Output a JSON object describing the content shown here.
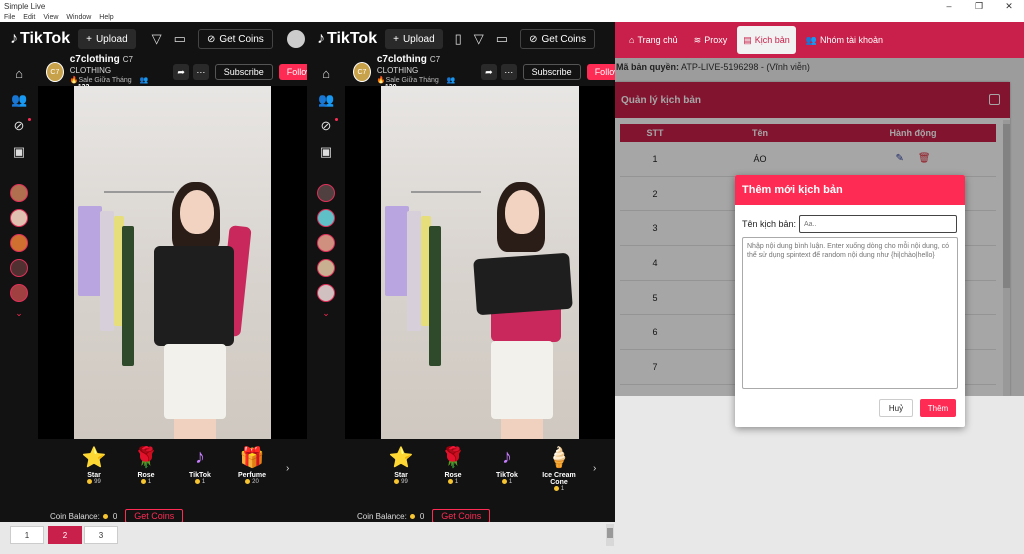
{
  "window": {
    "title": "Simple Live",
    "menu": [
      "File",
      "Edit",
      "View",
      "Window",
      "Help"
    ]
  },
  "tiktok_panes": [
    {
      "logo": "TikTok",
      "upload_label": "Upload",
      "get_coins_label": "Get Coins",
      "host": {
        "name": "c7clothing",
        "display": "C7 CLOTHING",
        "subtitle": "Sale Giữa Tháng",
        "viewers": "132",
        "avatar": "C7"
      },
      "subscribe_label": "Subscribe",
      "follow_label": "Follow",
      "gifts": [
        {
          "name": "Star",
          "price": "99",
          "icon": "⭐"
        },
        {
          "name": "Rose",
          "price": "1",
          "icon": "🌹"
        },
        {
          "name": "TikTok",
          "price": "1",
          "icon": "♪"
        },
        {
          "name": "Perfume",
          "price": "20",
          "icon": "🎁"
        }
      ],
      "balance_label": "Coin Balance:",
      "balance_value": "0",
      "balance_getcoins": "Get Coins"
    },
    {
      "logo": "TikTok",
      "upload_label": "Upload",
      "get_coins_label": "Get Coins",
      "host": {
        "name": "c7clothing",
        "display": "C7 CLOTHING",
        "subtitle": "Sale Giữa Tháng",
        "viewers": "130",
        "avatar": "C7"
      },
      "subscribe_label": "Subscribe",
      "follow_label": "Follow",
      "gifts": [
        {
          "name": "Star",
          "price": "99",
          "icon": "⭐"
        },
        {
          "name": "Rose",
          "price": "1",
          "icon": "🌹"
        },
        {
          "name": "TikTok",
          "price": "1",
          "icon": "♪"
        },
        {
          "name": "Ice Cream Cone",
          "price": "1",
          "icon": "🍦"
        }
      ],
      "balance_label": "Coin Balance:",
      "balance_value": "0",
      "balance_getcoins": "Get Coins"
    }
  ],
  "pager": {
    "pages": [
      "1",
      "2",
      "3"
    ],
    "active": "2"
  },
  "admin": {
    "nav": [
      {
        "label": "Trang chủ",
        "icon": "home-icon"
      },
      {
        "label": "Proxy",
        "icon": "wifi-icon"
      },
      {
        "label": "Kịch bản",
        "icon": "script-icon",
        "active": true
      },
      {
        "label": "Nhóm tài khoản",
        "icon": "users-icon"
      }
    ],
    "license_label": "Mã bản quyền:",
    "license_value": "ATP-LIVE-5196298 - (Vĩnh viễn)",
    "card_title": "Quản lý kịch bản",
    "table_headers": [
      "STT",
      "Tên",
      "Hành động"
    ],
    "rows": [
      {
        "stt": "1",
        "name": "ÁO"
      },
      {
        "stt": "2",
        "name": ""
      },
      {
        "stt": "3",
        "name": ""
      },
      {
        "stt": "4",
        "name": ""
      },
      {
        "stt": "5",
        "name": ""
      },
      {
        "stt": "6",
        "name": ""
      },
      {
        "stt": "7",
        "name": ""
      }
    ],
    "modal": {
      "title": "Thêm mới kịch bản",
      "name_label": "Tên kịch bản:",
      "name_placeholder": "Aa..",
      "content_placeholder": "Nhập nội dung bình luận. Enter xuống dòng cho mỗi nội dung, có thể sử dụng spintext để random nội dung như {hi|chào|hello}",
      "cancel_label": "Huỷ",
      "add_label": "Thêm"
    }
  },
  "colors": {
    "brand": "#c8204a",
    "tiktok_red": "#fe2c55",
    "dark": "#121212"
  }
}
